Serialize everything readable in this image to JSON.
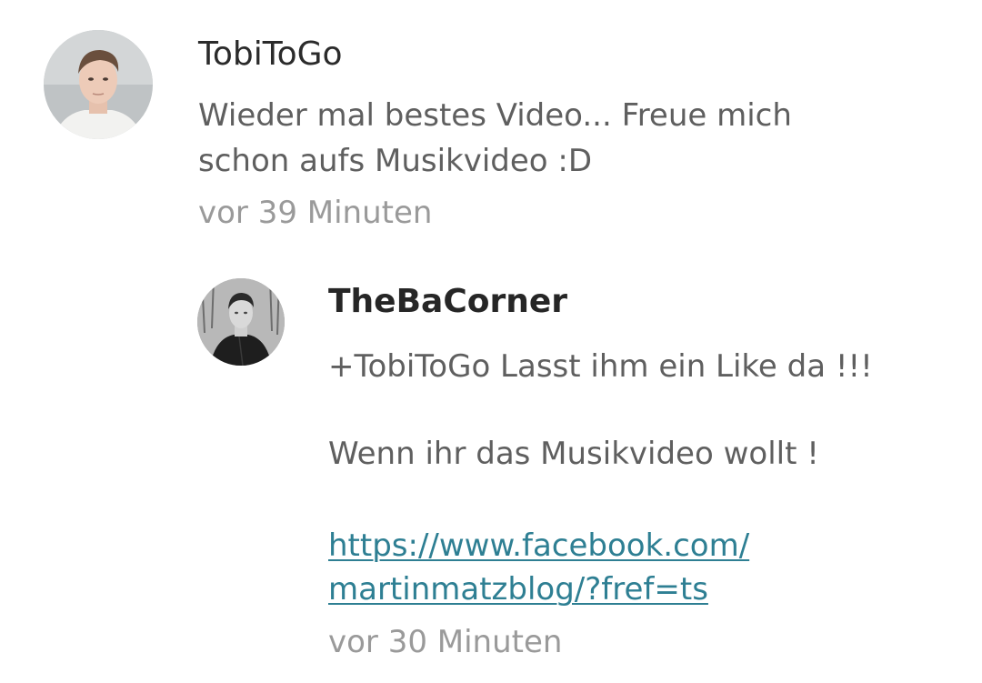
{
  "comments": [
    {
      "author": "TobiToGo",
      "text_lines": [
        "Wieder mal bestes Video... Freue mich",
        "schon aufs Musikvideo :D"
      ],
      "time": "vor 39 Minuten"
    }
  ],
  "reply": {
    "author": "TheBaCorner",
    "line1": "+TobiToGo Lasst ihm ein Like da !!!",
    "line2": "Wenn ihr das Musikvideo wollt !",
    "link_lines": [
      "https://www.facebook.com/",
      "martinmatzblog/?fref=ts"
    ],
    "time": "vor 30 Minuten"
  },
  "colors": {
    "author": "#2b2b2b",
    "body_text": "#5f5f5f",
    "timestamp": "#9a9a9a",
    "link": "#2e7f93"
  },
  "icons": {
    "comment_avatar": "user-avatar-photo",
    "reply_avatar": "user-avatar-photo"
  }
}
